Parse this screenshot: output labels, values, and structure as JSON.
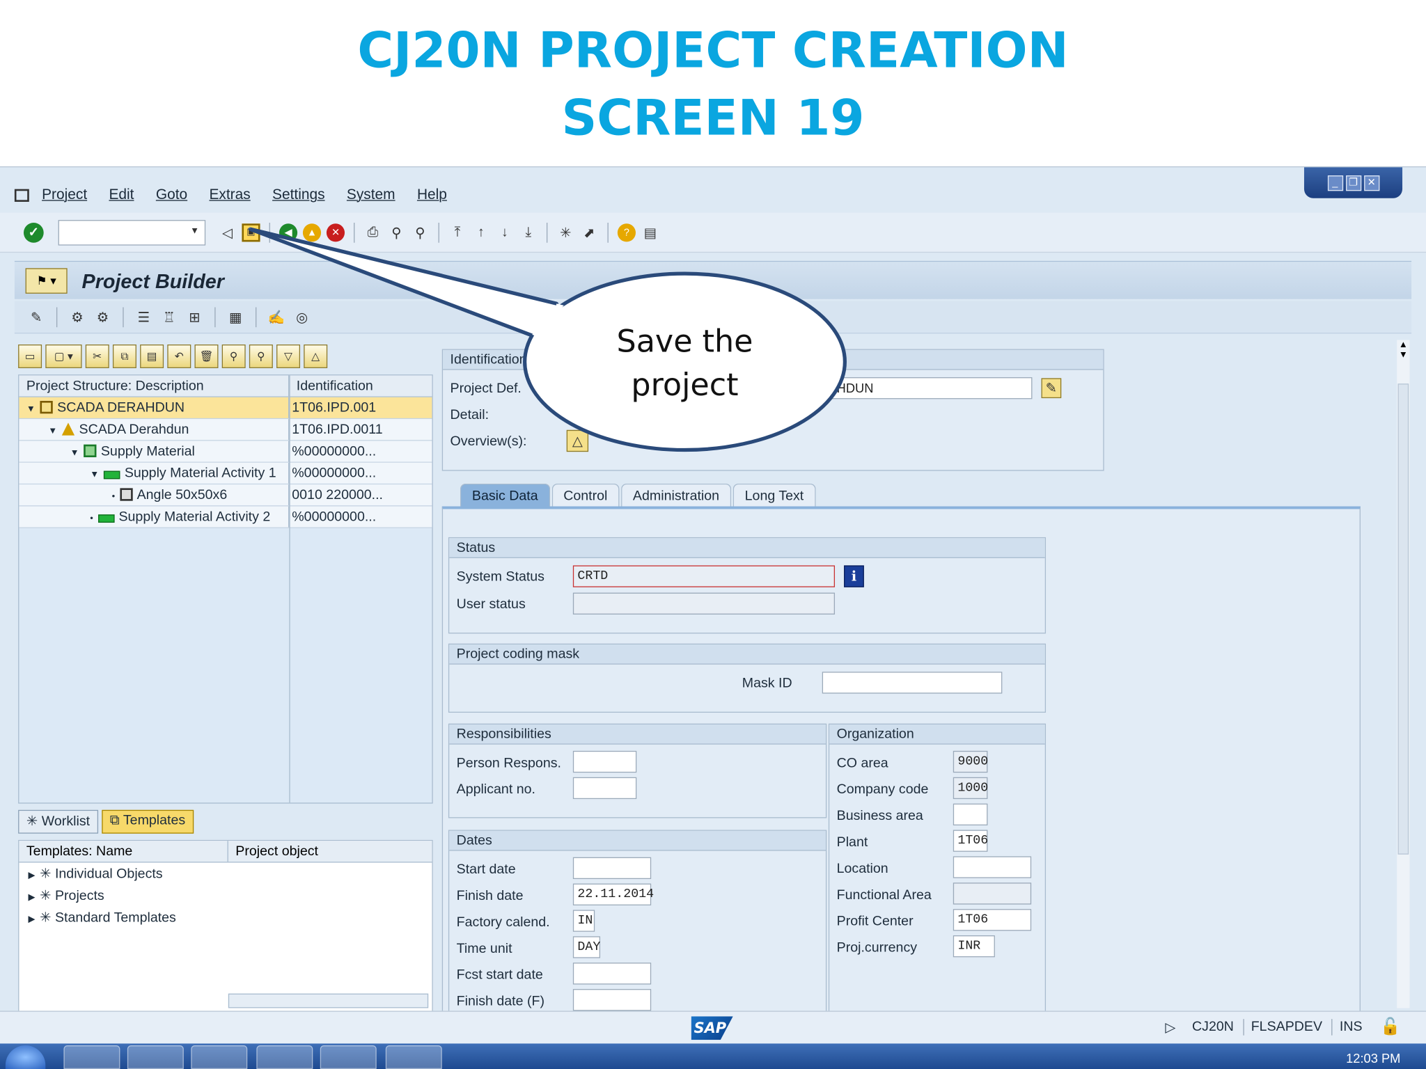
{
  "slide": {
    "title_line1": "CJ20N PROJECT CREATION",
    "title_line2": "SCREEN 19"
  },
  "menu": [
    "Project",
    "Edit",
    "Goto",
    "Extras",
    "Settings",
    "System",
    "Help"
  ],
  "app": {
    "title": "Project Builder"
  },
  "callout": {
    "line1": "Save the",
    "line2": "project"
  },
  "tree": {
    "headers": [
      "Project Structure: Description",
      "Identification"
    ],
    "rows": [
      {
        "label": "SCADA DERAHDUN",
        "id": "1T06.IPD.001"
      },
      {
        "label": "SCADA Derahdun",
        "id": "1T06.IPD.0011"
      },
      {
        "label": "Supply Material",
        "id": "%00000000..."
      },
      {
        "label": "Supply Material Activity 1",
        "id": "%00000000..."
      },
      {
        "label": "Angle 50x50x6",
        "id": "0010 220000..."
      },
      {
        "label": "Supply Material Activity 2",
        "id": "%00000000..."
      }
    ]
  },
  "templates": {
    "tabs": [
      "Worklist",
      "Templates"
    ],
    "headers": [
      "Templates: Name",
      "Project object"
    ],
    "rows": [
      "Individual Objects",
      "Projects",
      "Standard Templates"
    ]
  },
  "identification": {
    "title": "Identification",
    "project_def_label": "Project Def.",
    "project_def_value": "HDUN",
    "detail_label": "Detail:",
    "overview_label": "Overview(s):"
  },
  "tabs": [
    "Basic Data",
    "Control",
    "Administration",
    "Long Text"
  ],
  "status": {
    "title": "Status",
    "system_status_label": "System Status",
    "system_status_value": "CRTD",
    "user_status_label": "User status"
  },
  "coding_mask": {
    "title": "Project coding mask",
    "mask_id_label": "Mask ID"
  },
  "responsibilities": {
    "title": "Responsibilities",
    "person_label": "Person Respons.",
    "applicant_label": "Applicant no."
  },
  "dates": {
    "title": "Dates",
    "start_label": "Start date",
    "finish_label": "Finish date",
    "finish_value": "22.11.2014",
    "factory_label": "Factory calend.",
    "factory_value": "IN",
    "time_unit_label": "Time unit",
    "time_unit_value": "DAY",
    "fcst_start_label": "Fcst start date",
    "finish_f_label": "Finish date (F)"
  },
  "organization": {
    "title": "Organization",
    "co_area_label": "CO area",
    "co_area_value": "9000",
    "company_label": "Company code",
    "company_value": "1000",
    "business_label": "Business area",
    "plant_label": "Plant",
    "plant_value": "1T06",
    "location_label": "Location",
    "functional_label": "Functional Area",
    "profit_label": "Profit Center",
    "profit_value": "1T06",
    "currency_label": "Proj.currency",
    "currency_value": "INR"
  },
  "statusbar": {
    "transaction": "CJ20N",
    "system": "FLSAPDEV",
    "mode": "INS"
  },
  "taskbar": {
    "clock": "12:03 PM"
  },
  "colors": {
    "title_blue": "#0aa6e0",
    "selected_row": "#fbe49a",
    "callout_border": "#2a4a7a"
  }
}
